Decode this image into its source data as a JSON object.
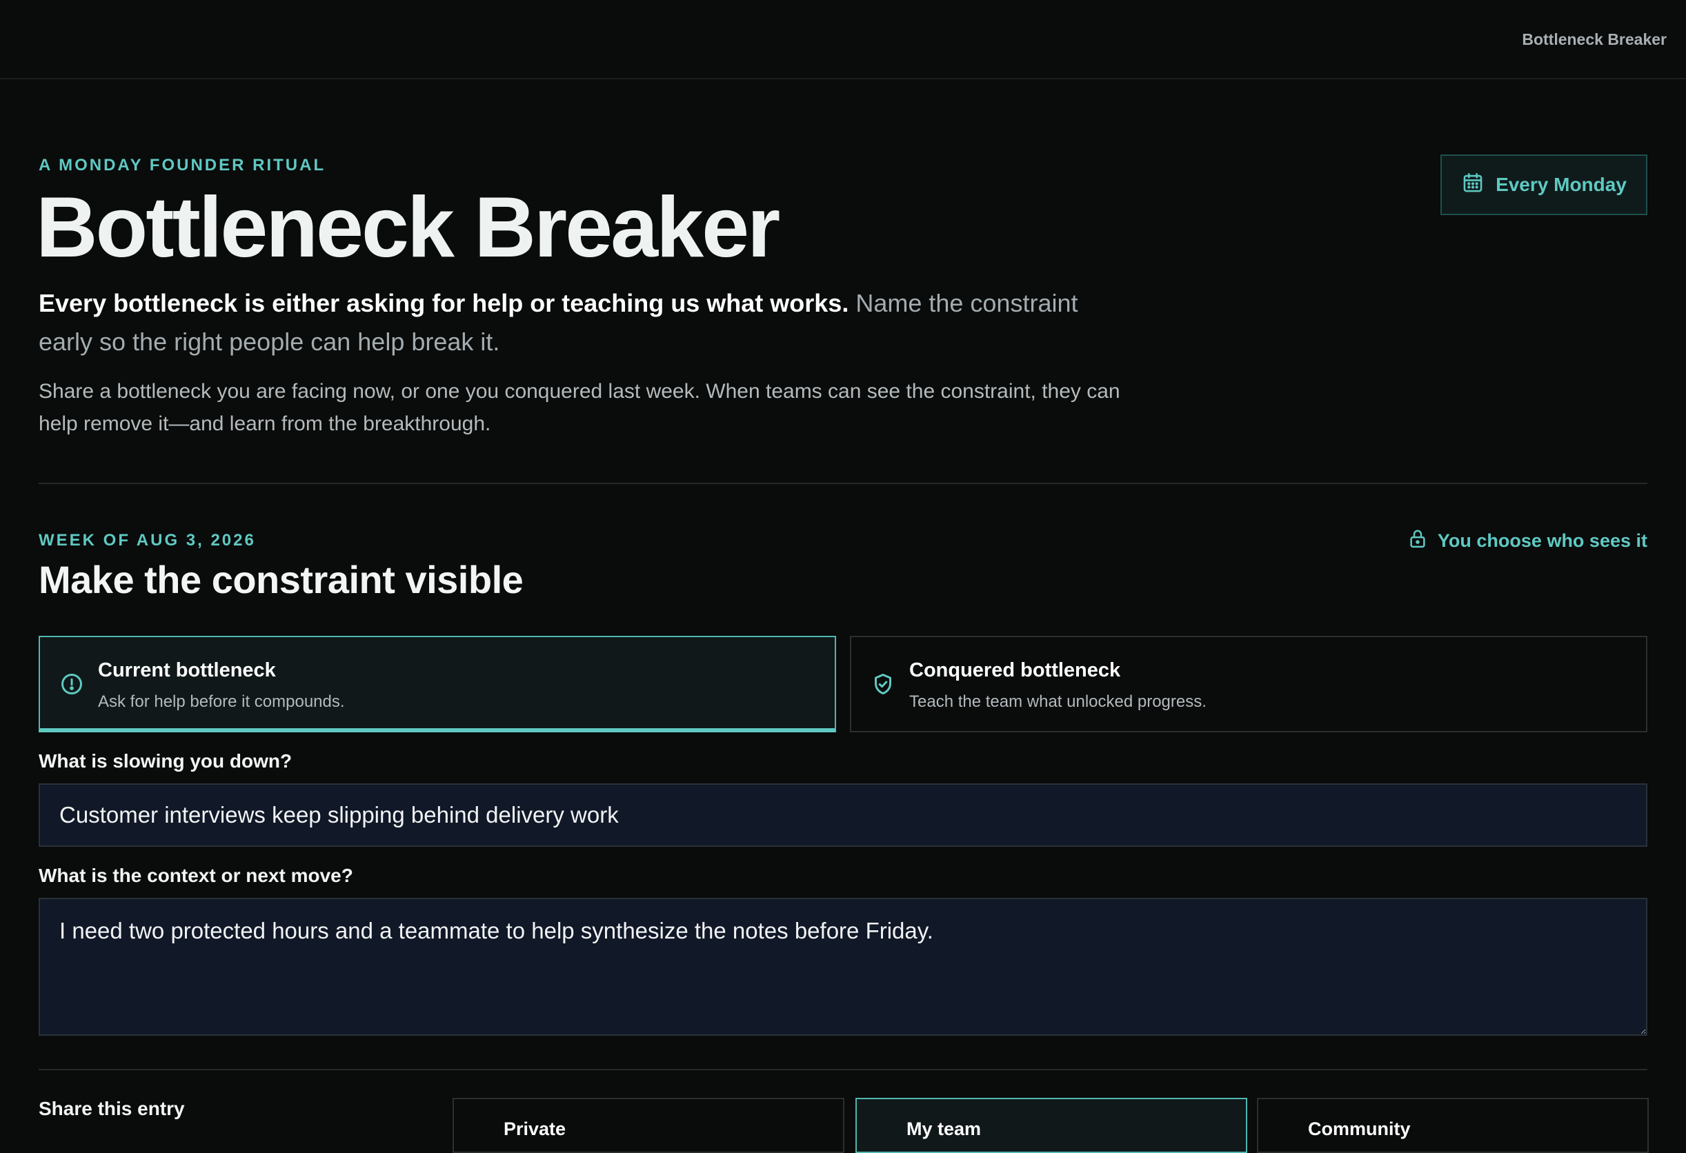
{
  "app": {
    "brand": "Bottleneck Breaker"
  },
  "hero": {
    "eyebrow": "A MONDAY FOUNDER RITUAL",
    "title": "Bottleneck Breaker",
    "schedule_label": "Every Monday",
    "lead_strong": "Every bottleneck is either asking for help or teaching us what works.",
    "lead_rest": " Name the constraint early so the right people can help break it.",
    "body": "Share a bottleneck you are facing now, or one you conquered last week. When teams can see the constraint, they can help remove it—and learn from the breakthrough."
  },
  "entry": {
    "week_label": "WEEK OF AUG 3, 2026",
    "title": "Make the constraint visible",
    "privacy_note": "You choose who sees it",
    "types": [
      {
        "title": "Current bottleneck",
        "subtitle": "Ask for help before it compounds.",
        "icon": "alert-circle-icon",
        "selected": true
      },
      {
        "title": "Conquered bottleneck",
        "subtitle": "Teach the team what unlocked progress.",
        "icon": "shield-check-icon",
        "selected": false
      }
    ],
    "slowing_label": "What is slowing you down?",
    "slowing_value": "Customer interviews keep slipping behind delivery work",
    "context_label": "What is the context or next move?",
    "context_value": "I need two protected hours and a teammate to help synthesize the notes before Friday.",
    "share_label": "Share this entry",
    "share_options": [
      {
        "label": "Private",
        "selected": false
      },
      {
        "label": "My team",
        "selected": true
      },
      {
        "label": "Community",
        "selected": false
      }
    ]
  },
  "colors": {
    "accent": "#5fc9c2",
    "background": "#0a0b0b",
    "input_background": "#111827",
    "selected_card": "#101819"
  }
}
